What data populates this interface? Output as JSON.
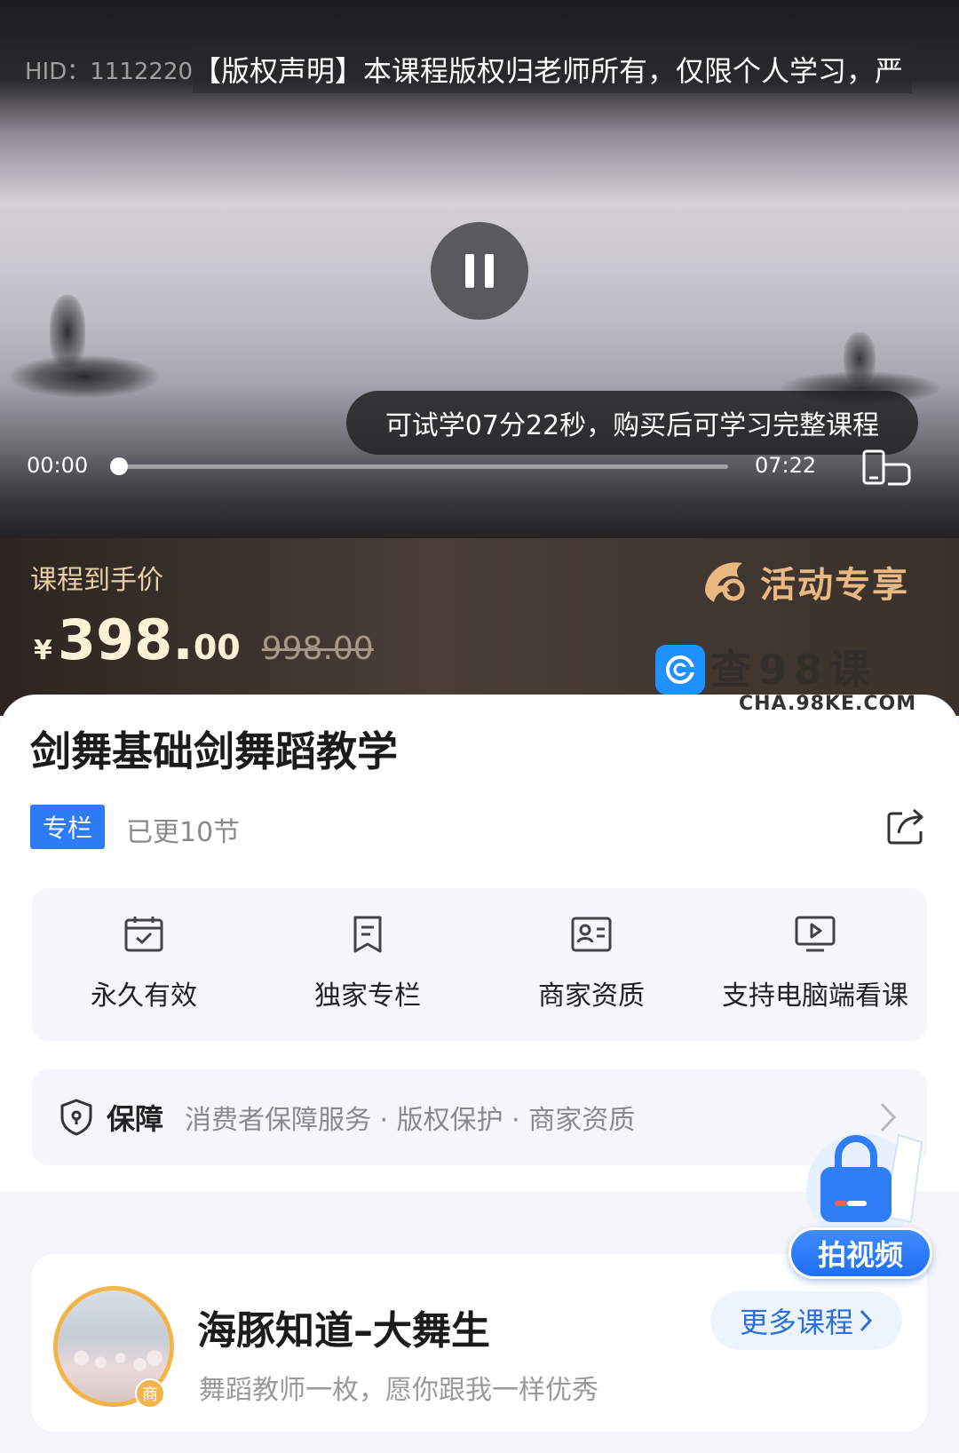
{
  "video": {
    "hid": "HID：1112220",
    "copyright_notice": "【版权声明】本课程版权归老师所有，仅限个人学习，严",
    "trial_tip": "可试学07分22秒，购买后可学习完整课程",
    "current_time": "00:00",
    "duration": "07:22",
    "progress_fraction": 0.0
  },
  "price": {
    "label": "课程到手价",
    "currency": "¥",
    "integer": "398.",
    "decimal": "00",
    "original": "998.00",
    "promo_text": "活动专享"
  },
  "watermark": {
    "text": "查98课",
    "url": "CHA.98KE.COM"
  },
  "course": {
    "title": "剑舞基础剑舞蹈教学",
    "tag": "专栏",
    "updated": "已更10节"
  },
  "features": [
    {
      "label": "永久有效",
      "icon": "calendar-check-icon"
    },
    {
      "label": "独家专栏",
      "icon": "bookmark-icon"
    },
    {
      "label": "商家资质",
      "icon": "id-card-icon"
    },
    {
      "label": "支持电脑端看课",
      "icon": "monitor-play-icon"
    }
  ],
  "guarantee": {
    "title": "保障",
    "desc": "消费者保障服务 · 版权保护 · 商家资质"
  },
  "teacher": {
    "name": "海豚知道–大舞生",
    "bio": "舞蹈教师一枚，愿你跟我一样优秀",
    "badge": "商",
    "more_label": "更多课程"
  },
  "fab": {
    "label": "拍视频"
  }
}
